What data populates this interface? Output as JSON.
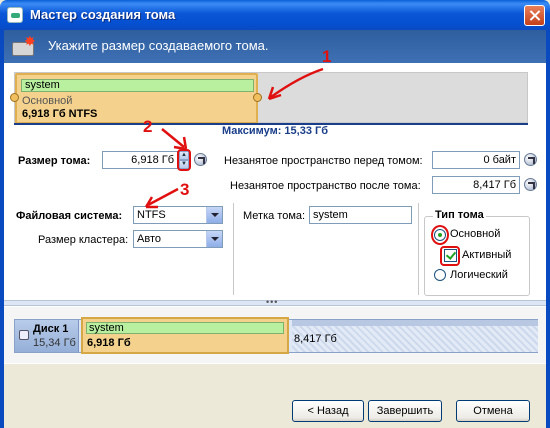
{
  "window": {
    "title": "Мастер создания тома",
    "heading": "Укажите размер создаваемого тома."
  },
  "volume_map": {
    "name": "system",
    "type": "Основной",
    "size_fs": "6,918 Гб NTFS",
    "maximum": "Максимум: 15,33 Гб"
  },
  "form": {
    "size_label": "Размер тома:",
    "size_value": "6,918 Гб",
    "free_before_label": "Незанятое пространство перед томом:",
    "free_before_value": "0 байт",
    "free_after_label": "Незанятое пространство после тома:",
    "free_after_value": "8,417 Гб",
    "fs_label": "Файловая система:",
    "fs_value": "NTFS",
    "cluster_label": "Размер кластера:",
    "cluster_value": "Авто",
    "volume_label_label": "Метка тома:",
    "volume_label_value": "system"
  },
  "volume_type": {
    "title": "Тип тома",
    "primary": "Основной",
    "primary_selected": true,
    "active": "Активный",
    "active_checked": true,
    "logical": "Логический",
    "logical_selected": false
  },
  "annotations": [
    "1",
    "2",
    "3"
  ],
  "disk": {
    "name": "Диск 1",
    "capacity": "15,34 Гб",
    "volume_name": "system",
    "volume_size": "6,918 Гб",
    "free_size": "8,417 Гб"
  },
  "buttons": {
    "back": "< Назад",
    "finish": "Завершить",
    "cancel": "Отмена"
  },
  "colors": {
    "title_bar": "#0A56D8",
    "header_band": "#2E5E9E",
    "volume_fill": "#F4D28E",
    "name_bar": "#B8F0A0",
    "annotation": "#E01010",
    "max_line": "#1A3E8A"
  }
}
